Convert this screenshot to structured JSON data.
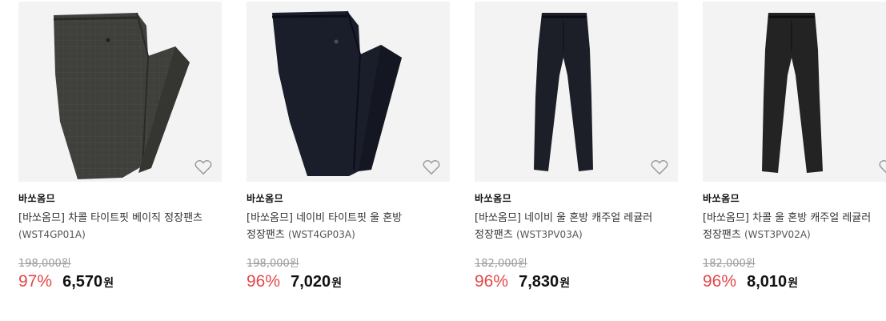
{
  "products": [
    {
      "brand": "바쏘옴므",
      "name": "[바쏘옴므] 차콜 타이트핏 베이직 정장팬츠",
      "code": "(WST4GP01A)",
      "original_price": "198,000원",
      "discount": "97%",
      "price": "6,570",
      "currency": "원",
      "image_icon": "charcoal-pants-folded-image",
      "pants_color": "#3c3c3a"
    },
    {
      "brand": "바쏘옴므",
      "name": "[바쏘옴므] 네이비 타이트핏 울 혼방 정장팬츠",
      "code": "(WST4GP03A)",
      "original_price": "198,000원",
      "discount": "96%",
      "price": "7,020",
      "currency": "원",
      "image_icon": "navy-pants-folded-image",
      "pants_color": "#1a1d2a"
    },
    {
      "brand": "바쏘옴므",
      "name": "[바쏘옴므] 네이비 울 혼방 캐주얼 레귤러 정장팬츠",
      "code": "(WST3PV03A)",
      "original_price": "182,000원",
      "discount": "96%",
      "price": "7,830",
      "currency": "원",
      "image_icon": "navy-pants-straight-image",
      "pants_color": "#1c1e28"
    },
    {
      "brand": "바쏘옴므",
      "name": "[바쏘옴므] 차콜 울 혼방 캐주얼 레귤러 정장팬츠",
      "code": "(WST3PV02A)",
      "original_price": "182,000원",
      "discount": "96%",
      "price": "8,010",
      "currency": "원",
      "image_icon": "charcoal-pants-straight-image",
      "pants_color": "#232324"
    }
  ],
  "wishlist_icon": "heart-icon",
  "accent_color": "#e34848"
}
